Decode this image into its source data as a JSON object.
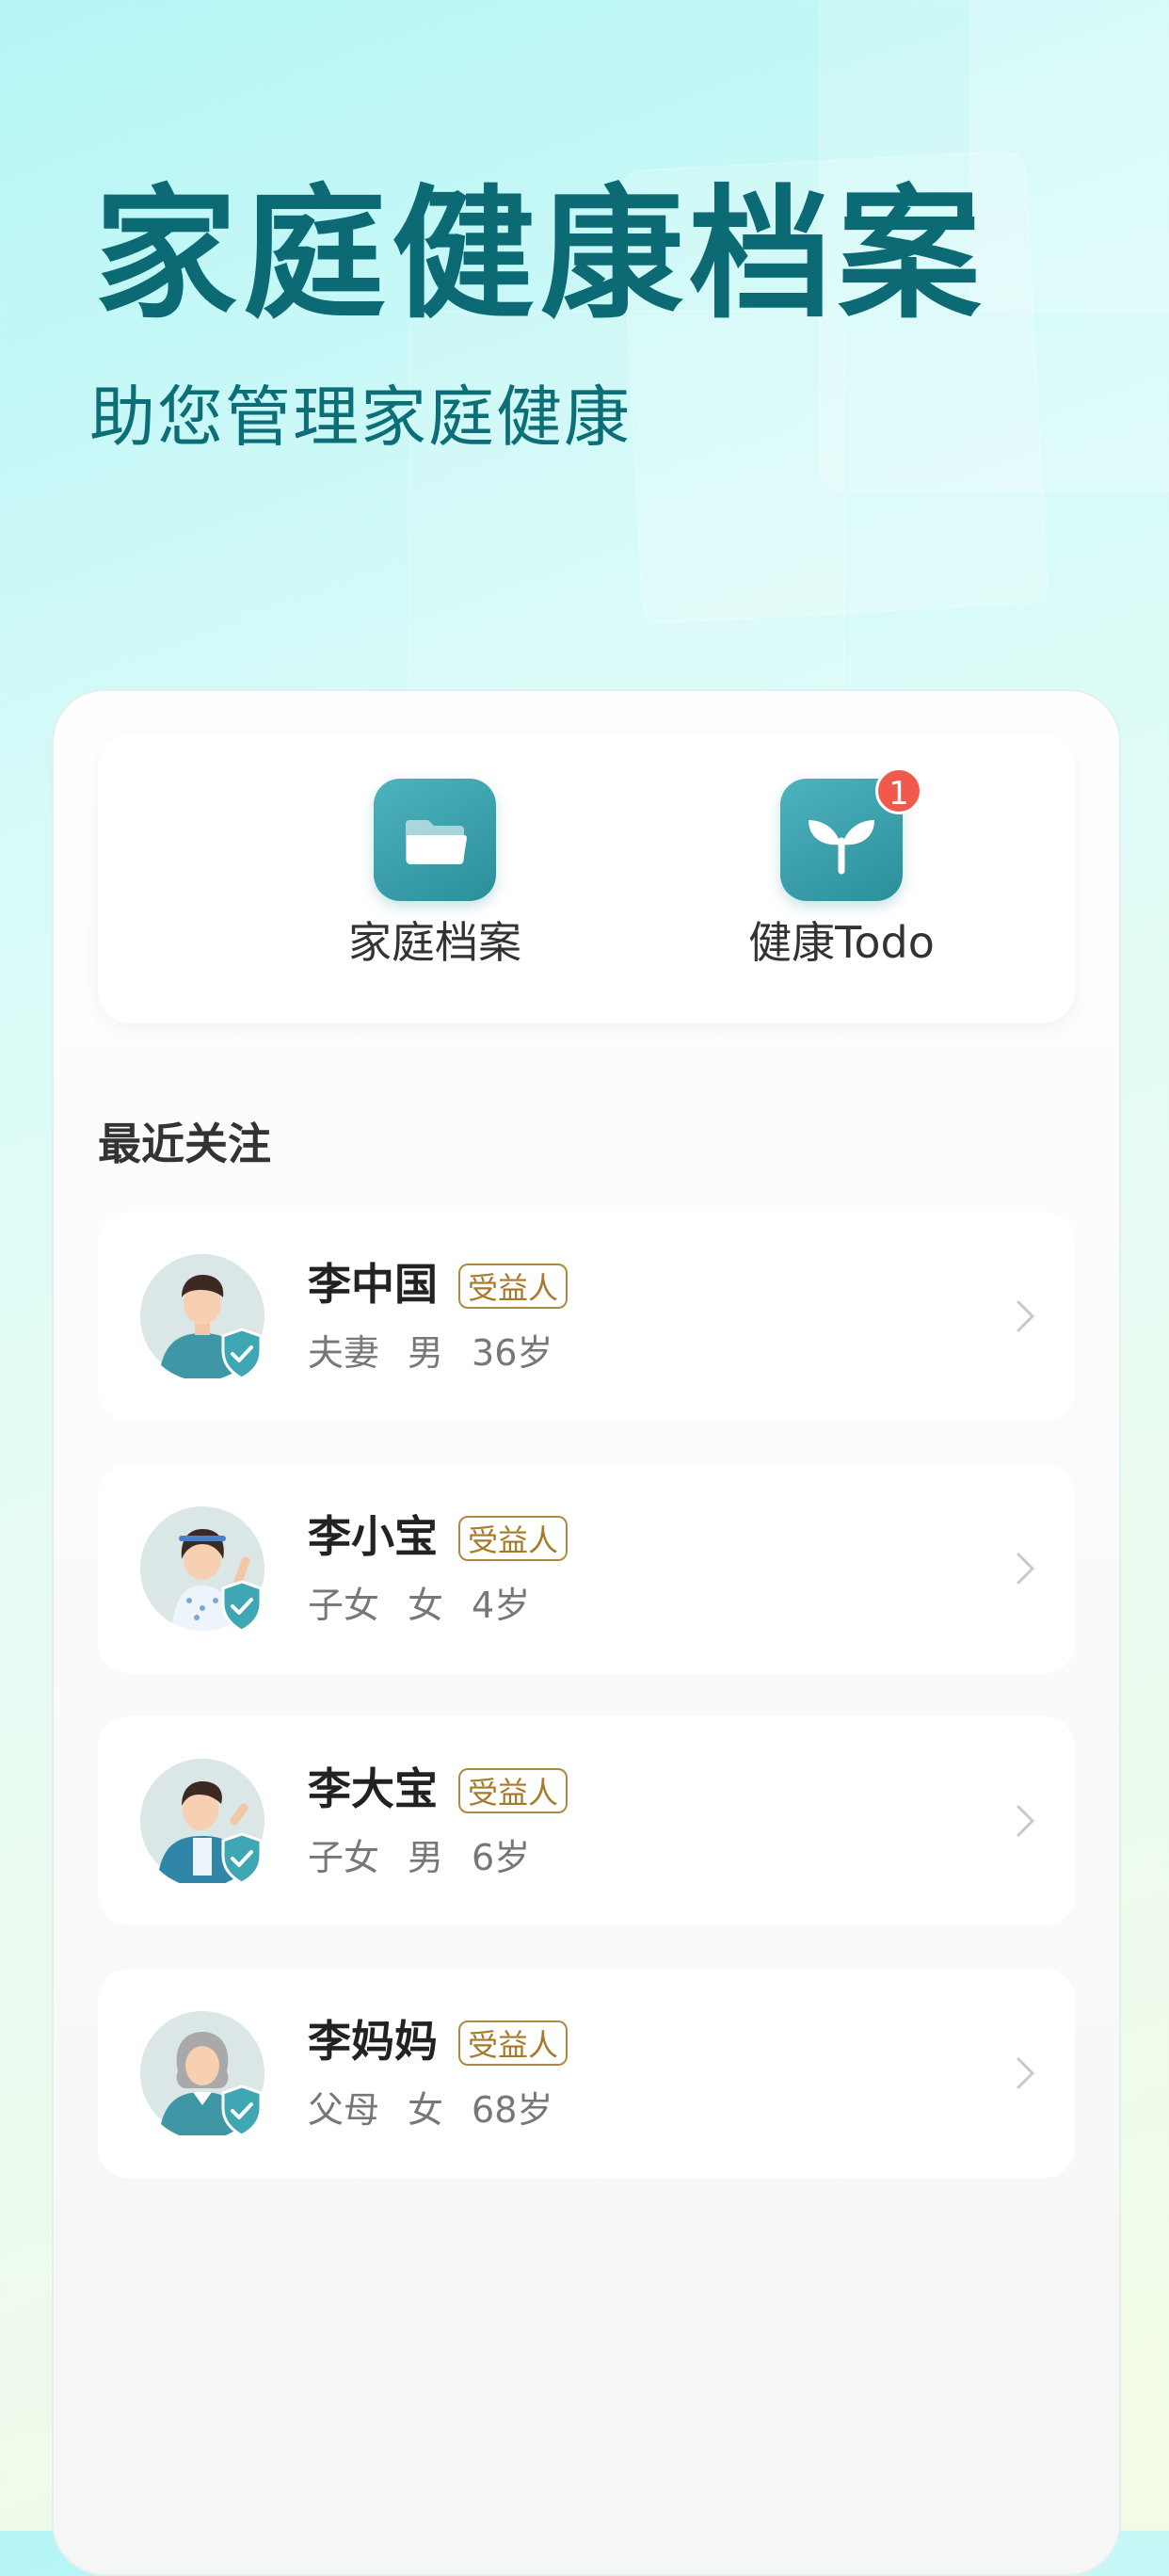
{
  "hero": {
    "title": "家庭健康档案",
    "subtitle": "助您管理家庭健康"
  },
  "quick_actions": [
    {
      "label": "家庭档案",
      "icon": "folder-icon"
    },
    {
      "label": "健康Todo",
      "icon": "sprout-icon",
      "badge": "1"
    }
  ],
  "recent": {
    "title": "最近关注",
    "people": [
      {
        "name": "李中国",
        "tag": "受益人",
        "relation": "夫妻",
        "gender": "男",
        "age": "36岁",
        "avatar": "man-avatar"
      },
      {
        "name": "李小宝",
        "tag": "受益人",
        "relation": "子女",
        "gender": "女",
        "age": "4岁",
        "avatar": "girl-avatar"
      },
      {
        "name": "李大宝",
        "tag": "受益人",
        "relation": "子女",
        "gender": "男",
        "age": "6岁",
        "avatar": "boy-avatar"
      },
      {
        "name": "李妈妈",
        "tag": "受益人",
        "relation": "父母",
        "gender": "女",
        "age": "68岁",
        "avatar": "grandma-avatar"
      }
    ]
  },
  "colors": {
    "brand": "#0b6a73",
    "icon_teal": "#2b8f9b",
    "badge_red": "#ef5a4c",
    "tag_gold": "#b0893e"
  }
}
